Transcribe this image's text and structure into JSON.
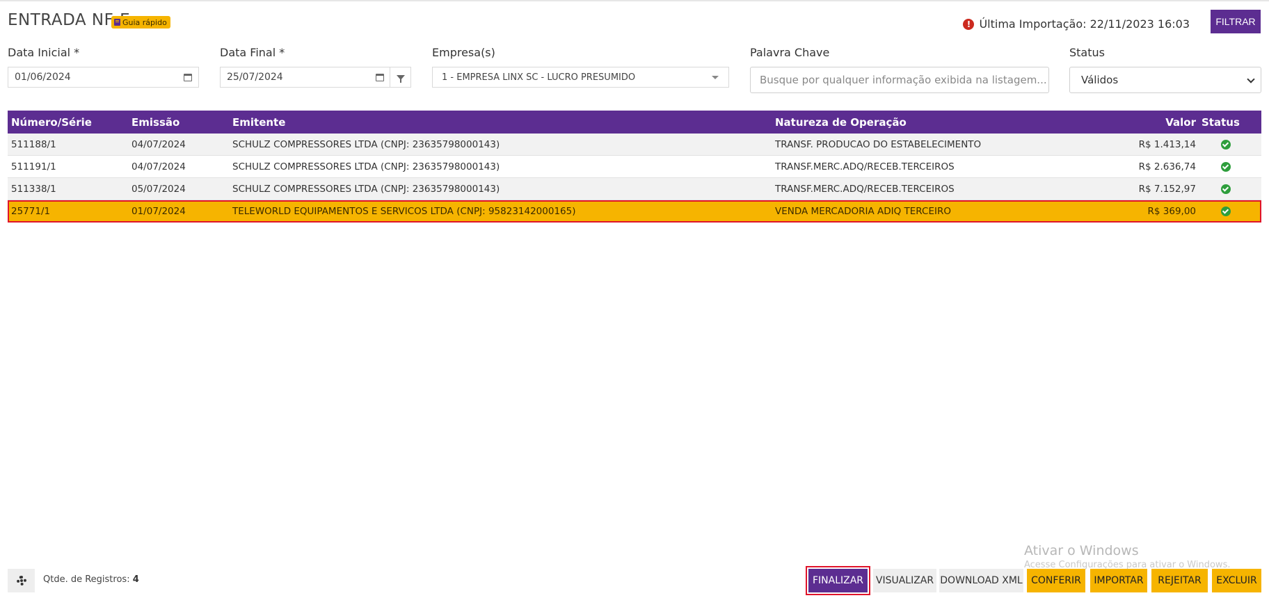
{
  "header": {
    "title": "ENTRADA NF-E",
    "guide_label": "Guia rápido",
    "last_import": "Última Importação: 22/11/2023 16:03",
    "filter_button": "FILTRAR"
  },
  "filters": {
    "start_date_label": "Data Inicial *",
    "start_date_value": "01/06/2024",
    "end_date_label": "Data Final *",
    "end_date_value": "25/07/2024",
    "company_label": "Empresa(s)",
    "company_value": "1 - EMPRESA LINX SC - LUCRO PRESUMIDO",
    "keyword_label": "Palavra Chave",
    "keyword_placeholder": "Busque por qualquer informação exibida na listagem...",
    "status_label": "Status",
    "status_value": "Válidos"
  },
  "table": {
    "headers": {
      "numero": "Número/Série",
      "emissao": "Emissão",
      "emitente": "Emitente",
      "natureza": "Natureza de Operação",
      "valor": "Valor",
      "status": "Status"
    },
    "rows": [
      {
        "numero": "511188/1",
        "emissao": "04/07/2024",
        "emitente": "SCHULZ COMPRESSORES LTDA (CNPJ: 23635798000143)",
        "natureza": "TRANSF. PRODUCAO DO ESTABELECIMENTO",
        "valor": "R$ 1.413,14",
        "status_icon": "check-circle-icon"
      },
      {
        "numero": "511191/1",
        "emissao": "04/07/2024",
        "emitente": "SCHULZ COMPRESSORES LTDA (CNPJ: 23635798000143)",
        "natureza": "TRANSF.MERC.ADQ/RECEB.TERCEIROS",
        "valor": "R$ 2.636,74",
        "status_icon": "check-circle-icon"
      },
      {
        "numero": "511338/1",
        "emissao": "05/07/2024",
        "emitente": "SCHULZ COMPRESSORES LTDA (CNPJ: 23635798000143)",
        "natureza": "TRANSF.MERC.ADQ/RECEB.TERCEIROS",
        "valor": "R$ 7.152,97",
        "status_icon": "check-circle-icon"
      },
      {
        "numero": "25771/1",
        "emissao": "01/07/2024",
        "emitente": "TELEWORLD EQUIPAMENTOS E SERVICOS LTDA (CNPJ: 95823142000165)",
        "natureza": "VENDA MERCADORIA ADIQ TERCEIRO",
        "valor": "R$ 369,00",
        "status_icon": "check-circle-icon",
        "selected": true
      }
    ]
  },
  "footer": {
    "records_label": "Qtde. de Registros:",
    "records_count": "4",
    "watermark_title": "Ativar o Windows",
    "watermark_sub": "Acesse Configurações para ativar o Windows.",
    "buttons": {
      "finalizar": "FINALIZAR",
      "visualizar": "VISUALIZAR",
      "download": "DOWNLOAD XML",
      "conferir": "CONFERIR",
      "importar": "IMPORTAR",
      "rejeitar": "REJEITAR",
      "excluir": "EXCLUIR"
    }
  },
  "colors": {
    "primary": "#5c2d91",
    "accent": "#f6b400",
    "selection_border": "#e0142a",
    "success": "#2e9e3c",
    "alert": "#cc2a1f"
  }
}
